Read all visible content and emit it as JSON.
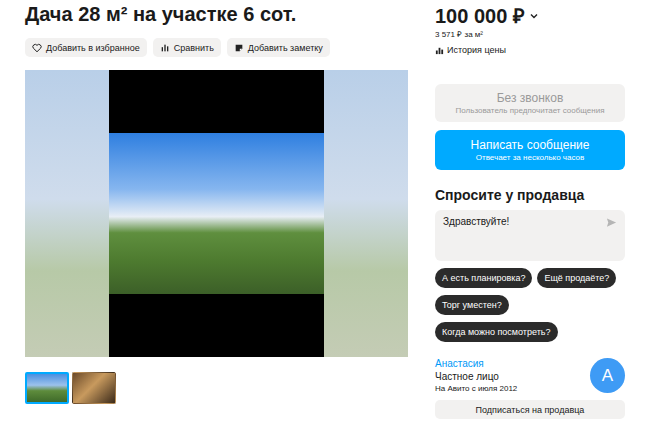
{
  "title": "Дача 28 м² на участке 6 сот.",
  "actions": [
    {
      "label": "Добавить в избранное"
    },
    {
      "label": "Сравнить"
    },
    {
      "label": "Добавить заметку"
    }
  ],
  "price": {
    "value": "100 000 ₽",
    "per_m2": "3 571 ₽ за м²",
    "history": "История цены"
  },
  "gallery": {
    "thumbnails": [
      {
        "selected": true
      },
      {
        "selected": false
      }
    ]
  },
  "contact": {
    "no_calls": {
      "title": "Без звонков",
      "subtitle": "Пользователь предпочитает сообщения",
      "disabled": true
    },
    "message": {
      "title": "Написать сообщение",
      "subtitle": "Отвечает за несколько часов"
    }
  },
  "ask": {
    "title": "Спросите у продавца",
    "message": "Здравствуйте!",
    "questions": [
      "А есть планировка?",
      "Ещё продаёте?",
      "Торг уместен?",
      "Когда можно посмотреть?"
    ]
  },
  "seller": {
    "name": "Анастасия",
    "type": "Частное лицо",
    "since": "На Авито с июля 2012",
    "avatar": "А",
    "subscribe": "Подписаться на продавца"
  }
}
